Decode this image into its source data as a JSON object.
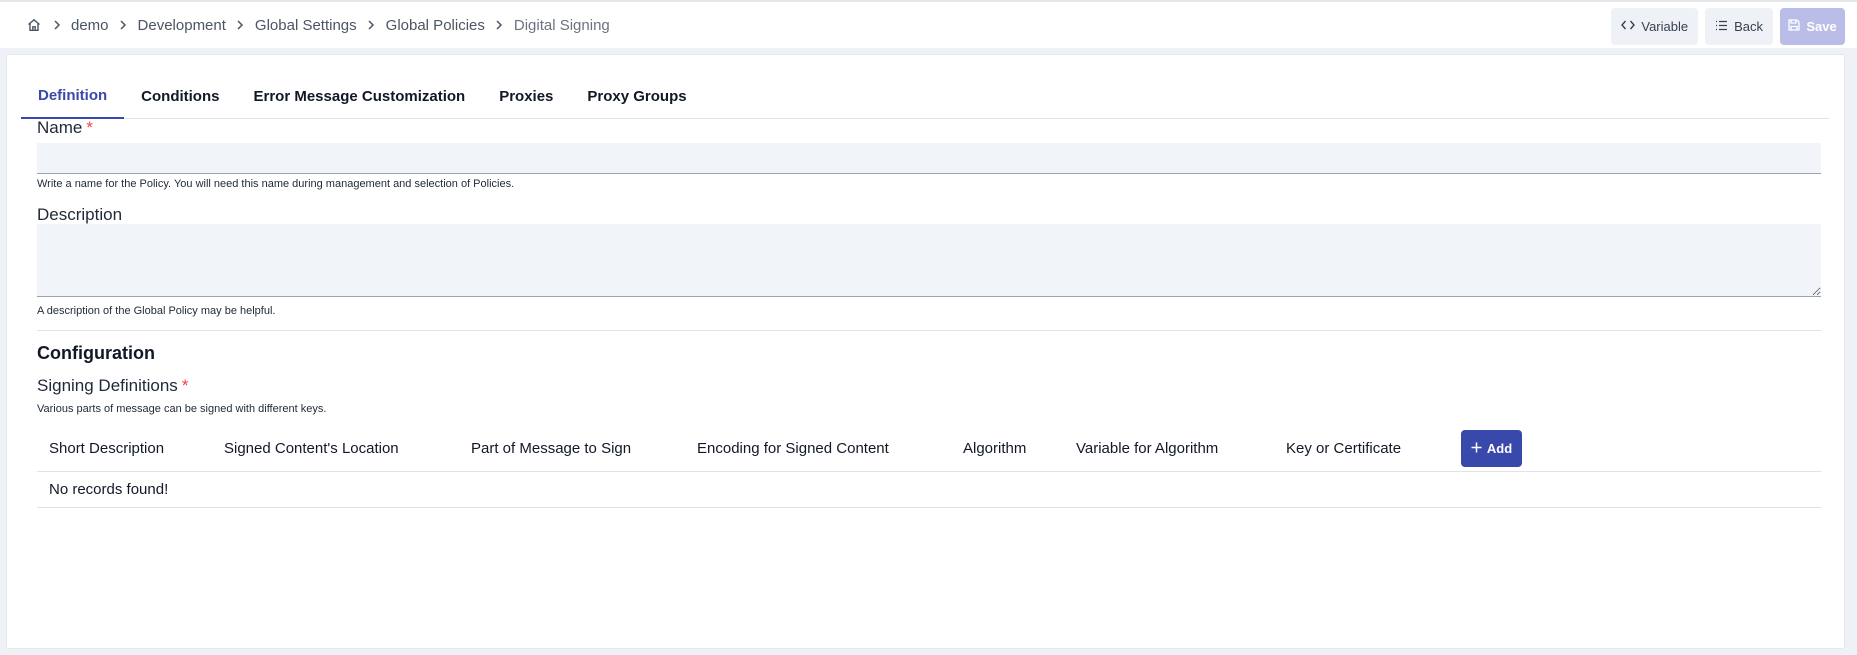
{
  "breadcrumb": {
    "home_icon": "home-icon",
    "items": [
      "demo",
      "Development",
      "Global Settings",
      "Global Policies",
      "Digital Signing"
    ]
  },
  "actions": {
    "variable_label": "Variable",
    "back_label": "Back",
    "save_label": "Save"
  },
  "tabs": [
    {
      "label": "Definition",
      "active": true
    },
    {
      "label": "Conditions",
      "active": false
    },
    {
      "label": "Error Message Customization",
      "active": false
    },
    {
      "label": "Proxies",
      "active": false
    },
    {
      "label": "Proxy Groups",
      "active": false
    }
  ],
  "form": {
    "name_label": "Name",
    "name_value": "",
    "name_help": "Write a name for the Policy. You will need this name during management and selection of Policies.",
    "description_label": "Description",
    "description_value": "",
    "description_help": "A description of the Global Policy may be helpful.",
    "required_mark": "*"
  },
  "configuration": {
    "title": "Configuration",
    "signing_label": "Signing Definitions",
    "signing_help": "Various parts of message can be signed with different keys.",
    "columns": [
      "Short Description",
      "Signed Content's Location",
      "Part of Message to Sign",
      "Encoding for Signed Content",
      "Algorithm",
      "Variable for Algorithm",
      "Key or Certificate"
    ],
    "add_label": "Add",
    "empty_message": "No records found!"
  },
  "colors": {
    "accent": "#3949ab",
    "save_disabled": "#b9bde8",
    "required": "#ef4444",
    "input_bg": "#f1f4f8"
  }
}
